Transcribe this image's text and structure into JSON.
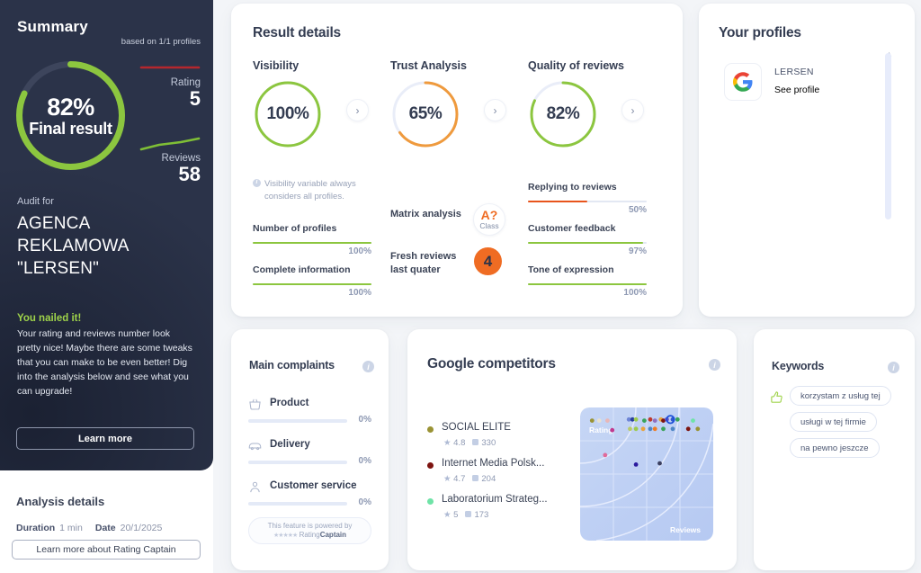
{
  "sidebar": {
    "summary_title": "Summary",
    "based_on": "based on 1/1 profiles",
    "final_gauge": {
      "value": 82,
      "value_label": "82%",
      "caption": "Final result",
      "color": "#8cc63f",
      "track": "#3b4358"
    },
    "rating": {
      "label": "Rating",
      "value": "5",
      "spark_color": "#b5272d"
    },
    "reviews": {
      "label": "Reviews",
      "value": "58",
      "spark_color": "#7fbf36"
    },
    "audit_for_label": "Audit for",
    "company_name": "AGENCA REKLAMOWA \"LERSEN\"",
    "nailed_title": "You nailed it!",
    "nailed_body": "Your rating and reviews number look pretty nice! Maybe there are some tweaks that you can make to be even better! Dig into the analysis below and see what you can upgrade!",
    "learn_more_label": "Learn more",
    "analysis_details": {
      "title": "Analysis details",
      "duration_label": "Duration",
      "duration_value": "1 min",
      "date_label": "Date",
      "date_value": "20/1/2025",
      "rating_captain_btn": "Learn more about Rating Captain"
    }
  },
  "result_details": {
    "title": "Result details",
    "columns": [
      {
        "title": "Visibility",
        "gauge": {
          "value": 100,
          "label": "100%",
          "color": "#8cc63f"
        },
        "chevron": "chevron-right",
        "note": "Visibility variable always considers all profiles.",
        "metrics": [
          {
            "label": "Number of profiles",
            "pct_label": "100%",
            "value": 100,
            "color": "#8cc63f"
          },
          {
            "label": "Complete information",
            "pct_label": "100%",
            "value": 100,
            "color": "#8cc63f"
          }
        ]
      },
      {
        "title": "Trust Analysis",
        "gauge": {
          "value": 65,
          "label": "65%",
          "color": "#ef9a3d"
        },
        "chevron": "chevron-right",
        "badges": [
          {
            "label": "Matrix analysis",
            "type": "class",
            "value": "A?",
            "sub": "Class"
          },
          {
            "label": "Fresh reviews last quater",
            "type": "number",
            "value": "4"
          }
        ]
      },
      {
        "title": "Quality of reviews",
        "gauge": {
          "value": 82,
          "label": "82%",
          "color": "#8cc63f"
        },
        "chevron": "chevron-right",
        "metrics": [
          {
            "label": "Replying to reviews",
            "pct_label": "50%",
            "value": 50,
            "color": "#e8541c"
          },
          {
            "label": "Customer feedback",
            "pct_label": "97%",
            "value": 97,
            "color": "#8cc63f"
          },
          {
            "label": "Tone of expression",
            "pct_label": "100%",
            "value": 100,
            "color": "#8cc63f"
          }
        ]
      }
    ]
  },
  "your_profiles": {
    "title": "Your profiles",
    "items": [
      {
        "icon": "google-logo",
        "name": "LERSEN",
        "link_label": "See profile"
      }
    ]
  },
  "main_complaints": {
    "title": "Main complaints",
    "info": "info-icon",
    "items": [
      {
        "icon": "basket-icon",
        "label": "Product",
        "pct_label": "0%",
        "value": 0
      },
      {
        "icon": "truck-icon",
        "label": "Delivery",
        "pct_label": "0%",
        "value": 0
      },
      {
        "icon": "person-icon",
        "label": "Customer service",
        "pct_label": "0%",
        "value": 0
      }
    ],
    "powered_line1": "This feature is powered by",
    "powered_stars": "★★★★★",
    "powered_brand_1": "Rating",
    "powered_brand_2": "Captain"
  },
  "google_competitors": {
    "title": "Google competitors",
    "info": "info-icon",
    "items": [
      {
        "name": "SOCIAL ELITE",
        "color": "#9a9335",
        "rating": "4.8",
        "reviews": "330"
      },
      {
        "name": "Internet Media Polsk...",
        "color": "#7d1410",
        "rating": "4.7",
        "reviews": "204"
      },
      {
        "name": "Laboratorium Strateg...",
        "color": "#6fe3a7",
        "rating": "5",
        "reviews": "173"
      }
    ],
    "chart_axis_y": "Rating",
    "chart_axis_x": "Reviews"
  },
  "keywords": {
    "title": "Keywords",
    "info": "info-icon",
    "thumb_icon": "thumbs-up-icon",
    "chips": [
      "korzystam z usług tej",
      "usługi w tej firmie",
      "na pewno jeszcze"
    ]
  },
  "chart_data": {
    "type": "scatter",
    "title": "Google competitors",
    "xlabel": "Reviews",
    "ylabel": "Rating",
    "grid": true,
    "points": [
      {
        "x": 4,
        "y": 95,
        "color": "#9a9335"
      },
      {
        "x": 10,
        "y": 95,
        "color": "#e8e2d0"
      },
      {
        "x": 17,
        "y": 95,
        "color": "#e8b7b7"
      },
      {
        "x": 35,
        "y": 96,
        "color": "#6f86d6"
      },
      {
        "x": 38,
        "y": 96,
        "color": "#2b3f9e"
      },
      {
        "x": 41,
        "y": 96,
        "color": "#9ecb4f"
      },
      {
        "x": 48,
        "y": 95,
        "color": "#3aa35b"
      },
      {
        "x": 53,
        "y": 96,
        "color": "#c0392b"
      },
      {
        "x": 57,
        "y": 95,
        "color": "#8e6fc0"
      },
      {
        "x": 62,
        "y": 96,
        "color": "#e8a33d"
      },
      {
        "x": 64,
        "y": 95,
        "color": "#7d1410"
      },
      {
        "x": 67,
        "y": 96,
        "color": "#6f4fc0"
      },
      {
        "x": 72,
        "y": 96,
        "color": "#2f58d0"
      },
      {
        "x": 76,
        "y": 96,
        "color": "#3aa35b"
      },
      {
        "x": 89,
        "y": 95,
        "color": "#6fe3a7"
      },
      {
        "x": 36,
        "y": 88,
        "color": "#b8c96a"
      },
      {
        "x": 41,
        "y": 88,
        "color": "#9ecb4f"
      },
      {
        "x": 47,
        "y": 88,
        "color": "#e8a33d"
      },
      {
        "x": 53,
        "y": 88,
        "color": "#4f86c6"
      },
      {
        "x": 57,
        "y": 88,
        "color": "#f07c24"
      },
      {
        "x": 64,
        "y": 88,
        "color": "#3aa35b"
      },
      {
        "x": 72,
        "y": 88,
        "color": "#4f86c6"
      },
      {
        "x": 21,
        "y": 87,
        "color": "#c0398f"
      },
      {
        "x": 85,
        "y": 88,
        "color": "#7d1410"
      },
      {
        "x": 93,
        "y": 88,
        "color": "#9a9335"
      },
      {
        "x": 15,
        "y": 66,
        "color": "#e06a9a"
      },
      {
        "x": 41,
        "y": 58,
        "color": "#2b1a9e"
      },
      {
        "x": 61,
        "y": 59,
        "color": "#3b3f60"
      }
    ]
  }
}
